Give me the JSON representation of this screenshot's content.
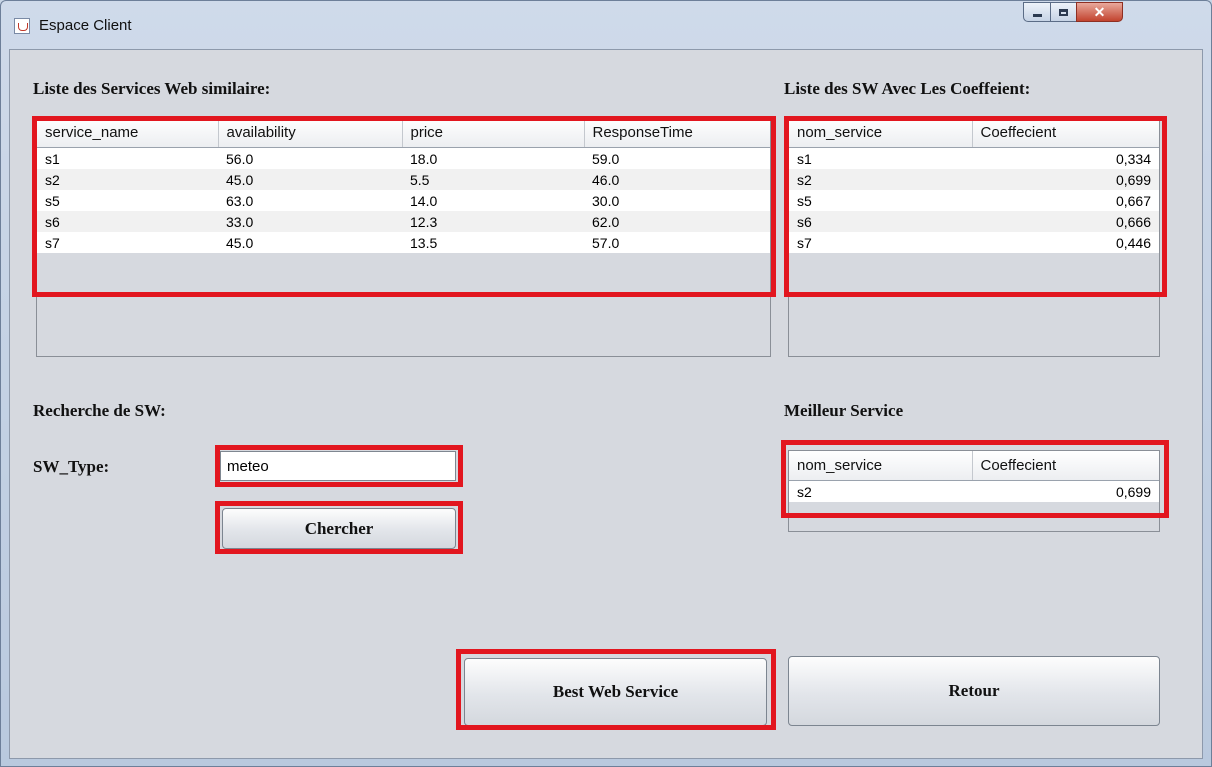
{
  "window": {
    "title": "Espace Client"
  },
  "similar_services": {
    "title": "Liste des Services Web similaire:",
    "columns": [
      "service_name",
      "availability",
      "price",
      "ResponseTime"
    ],
    "rows": [
      [
        "s1",
        "56.0",
        "18.0",
        "59.0"
      ],
      [
        "s2",
        "45.0",
        "5.5",
        "46.0"
      ],
      [
        "s5",
        "63.0",
        "14.0",
        "30.0"
      ],
      [
        "s6",
        "33.0",
        "12.3",
        "62.0"
      ],
      [
        "s7",
        "45.0",
        "13.5",
        "57.0"
      ]
    ]
  },
  "coefficients": {
    "title": "Liste des SW Avec Les Coeffeient:",
    "columns": [
      "nom_service",
      "Coeffecient"
    ],
    "rows": [
      [
        "s1",
        "0,334"
      ],
      [
        "s2",
        "0,699"
      ],
      [
        "s5",
        "0,667"
      ],
      [
        "s6",
        "0,666"
      ],
      [
        "s7",
        "0,446"
      ]
    ]
  },
  "search": {
    "title": "Recherche de SW:",
    "type_label": "SW_Type:",
    "type_value": "meteo",
    "button_label": "Chercher"
  },
  "best": {
    "title": "Meilleur Service",
    "columns": [
      "nom_service",
      "Coeffecient"
    ],
    "rows": [
      [
        "s2",
        "0,699"
      ]
    ]
  },
  "actions": {
    "best_label": "Best Web Service",
    "back_label": "Retour"
  },
  "colors": {
    "highlight": "#e2161f"
  }
}
